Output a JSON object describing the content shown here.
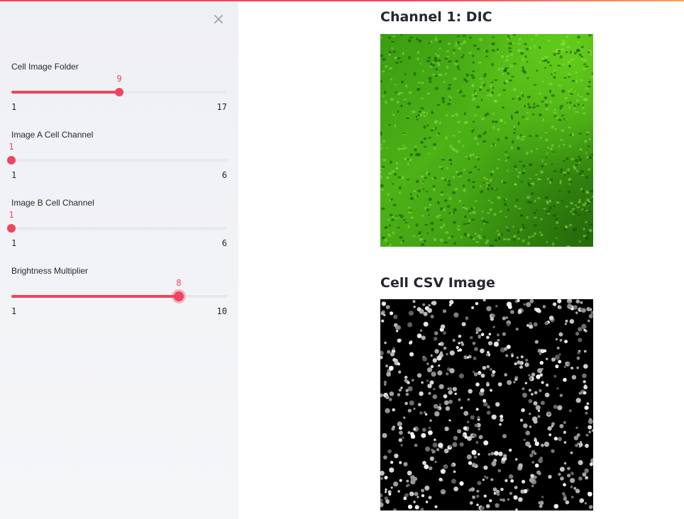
{
  "colors": {
    "accent": "#f0455e",
    "sidebar_bg": "#eff0f4",
    "track_bg": "#e6e8ee"
  },
  "sidebar": {
    "close_icon": "close-icon",
    "close_glyph": "×",
    "sliders": [
      {
        "label": "Cell Image Folder",
        "value": "9",
        "min": "1",
        "max": "17"
      },
      {
        "label": "Image A Cell Channel",
        "value": "1",
        "min": "1",
        "max": "6"
      },
      {
        "label": "Image B Cell Channel",
        "value": "1",
        "min": "1",
        "max": "6"
      },
      {
        "label": "Brightness Multiplier",
        "value": "8",
        "min": "1",
        "max": "10"
      }
    ]
  },
  "main": {
    "dic_title": "Channel 1: DIC",
    "csv_title": "Cell CSV Image"
  }
}
